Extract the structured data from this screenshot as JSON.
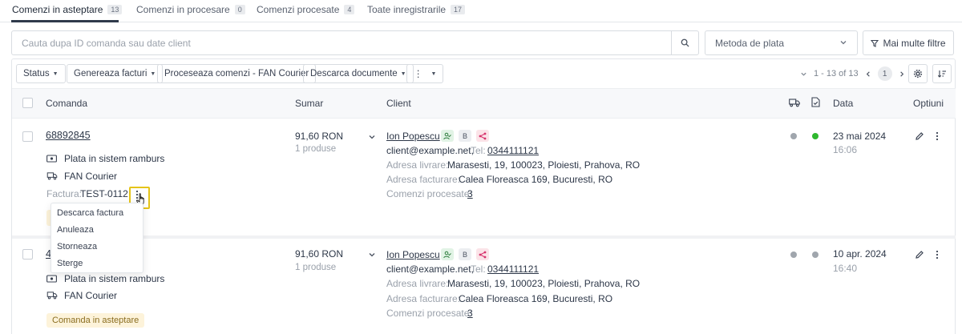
{
  "tabs": [
    {
      "label": "Comenzi in asteptare",
      "count": "13"
    },
    {
      "label": "Comenzi in procesare",
      "count": "0"
    },
    {
      "label": "Comenzi procesate",
      "count": "4"
    },
    {
      "label": "Toate inregistrarile",
      "count": "17"
    }
  ],
  "search": {
    "placeholder": "Cauta dupa ID comanda sau date client"
  },
  "payment_select": {
    "label": "Metoda de plata"
  },
  "more_filters": {
    "label": "Mai multe filtre"
  },
  "toolbar": {
    "status": "Status",
    "generate_invoices": "Genereaza facturi",
    "process_orders": "Proceseaza comenzi - FAN Courier",
    "download_docs": "Descarca documente",
    "more": "⋮"
  },
  "pager": {
    "range": "1 - 13 of 13",
    "page": "1"
  },
  "columns": {
    "order": "Comanda",
    "summary": "Sumar",
    "client": "Client",
    "date": "Data",
    "options": "Optiuni"
  },
  "rows": [
    {
      "id": "68892845",
      "payment": "Plata in sistem ramburs",
      "courier": "FAN Courier",
      "invoice_label": "Factura:",
      "invoice": "TEST-0112",
      "amount": "91,60 RON",
      "products": "1 produse",
      "client_name": "Ion Popescu",
      "tag_b": "B",
      "email": "client@example.net,",
      "tel_label": "Tel:",
      "tel": "0344111121",
      "delivery_label": "Adresa livrare:",
      "delivery": "Marasesti, 19, 100023, Ploiesti, Prahova, RO",
      "billing_label": "Adresa facturare:",
      "billing": "Calea Floreasca 169, Bucuresti, RO",
      "processed_label": "Comenzi procesate:",
      "processed": "3",
      "date": "23 mai 2024",
      "time": "16:06",
      "status_color": "#a0a6ad",
      "doc_color": "#2eb82e"
    },
    {
      "id": "4",
      "payment": "Plata in sistem ramburs",
      "courier": "FAN Courier",
      "badge": "Comanda in asteptare",
      "amount": "91,60 RON",
      "products": "1 produse",
      "client_name": "Ion Popescu",
      "tag_b": "B",
      "email": "client@example.net,",
      "tel_label": "Tel:",
      "tel": "0344111121",
      "delivery_label": "Adresa livrare:",
      "delivery": "Marasesti, 19, 100023, Ploiesti, Prahova, RO",
      "billing_label": "Adresa facturare:",
      "billing": "Calea Floreasca 169, Bucuresti, RO",
      "processed_label": "Comenzi procesate:",
      "processed": "3",
      "date": "10 apr. 2024",
      "time": "16:40",
      "status_color": "#a0a6ad",
      "doc_color": "#a0a6ad"
    }
  ],
  "invoice_menu": [
    "Descarca factura",
    "Anuleaza",
    "Storneaza",
    "Sterge"
  ],
  "colors": {
    "accent": "#2f3a4b",
    "highlight": "#e5c419",
    "badge_bg": "#fdf3da"
  }
}
